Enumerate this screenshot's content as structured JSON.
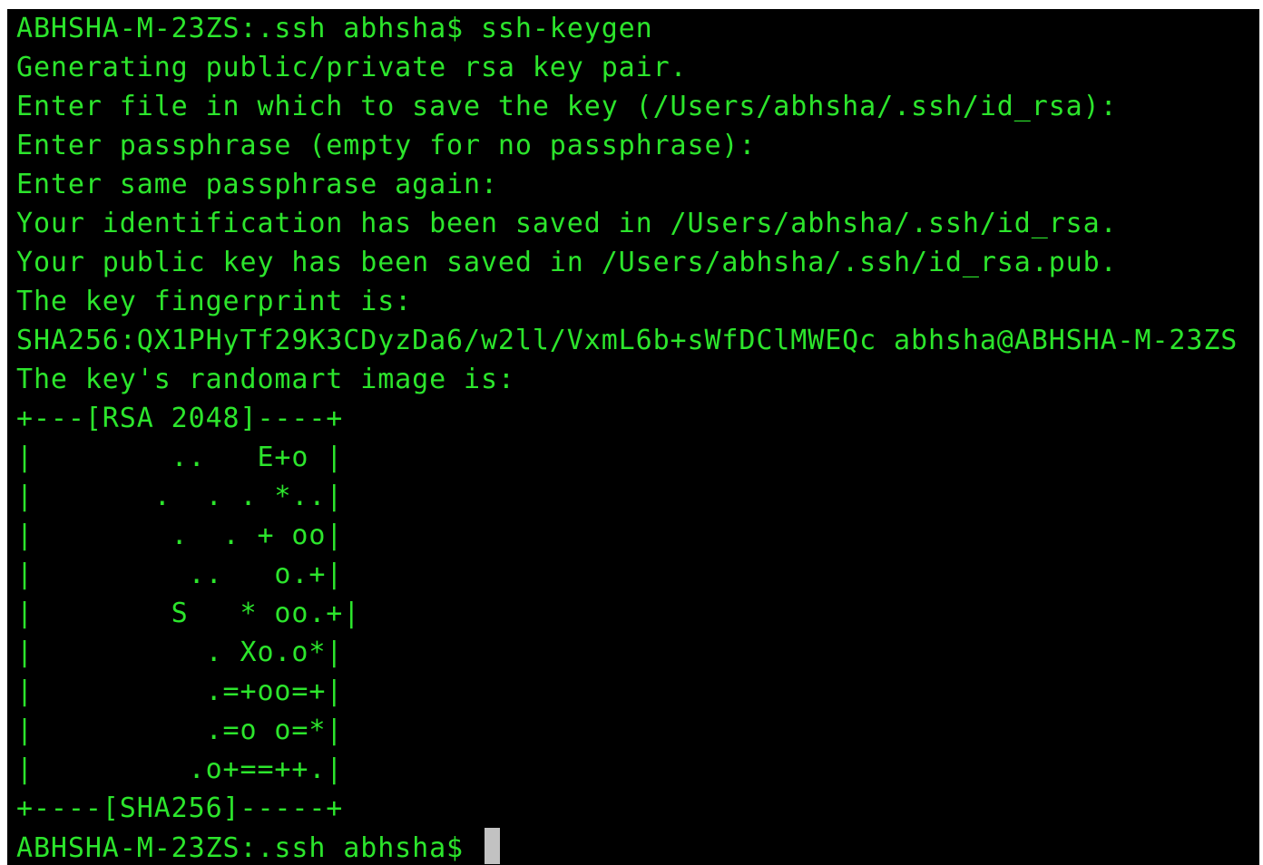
{
  "terminal": {
    "lines": [
      "ABHSHA-M-23ZS:.ssh abhsha$ ssh-keygen",
      "Generating public/private rsa key pair.",
      "Enter file in which to save the key (/Users/abhsha/.ssh/id_rsa):",
      "Enter passphrase (empty for no passphrase):",
      "Enter same passphrase again:",
      "Your identification has been saved in /Users/abhsha/.ssh/id_rsa.",
      "Your public key has been saved in /Users/abhsha/.ssh/id_rsa.pub.",
      "The key fingerprint is:",
      "SHA256:QX1PHyTf29K3CDyzDa6/w2ll/VxmL6b+sWfDClMWEQc abhsha@ABHSHA-M-23ZS",
      "The key's randomart image is:",
      "+---[RSA 2048]----+",
      "|        ..   E+o |",
      "|       .  . . *..|",
      "|        .  . + oo|",
      "|         ..   o.+|",
      "|        S   * oo.+|",
      "|          . Xo.o*|",
      "|          .=+oo=+|",
      "|          .=o o=*|",
      "|         .o+==++.|",
      "+----[SHA256]-----+"
    ],
    "prompt": "ABHSHA-M-23ZS:.ssh abhsha$ ",
    "colors": {
      "background": "#000000",
      "text": "#2ce52c",
      "cursor": "#c2c2c2"
    }
  }
}
